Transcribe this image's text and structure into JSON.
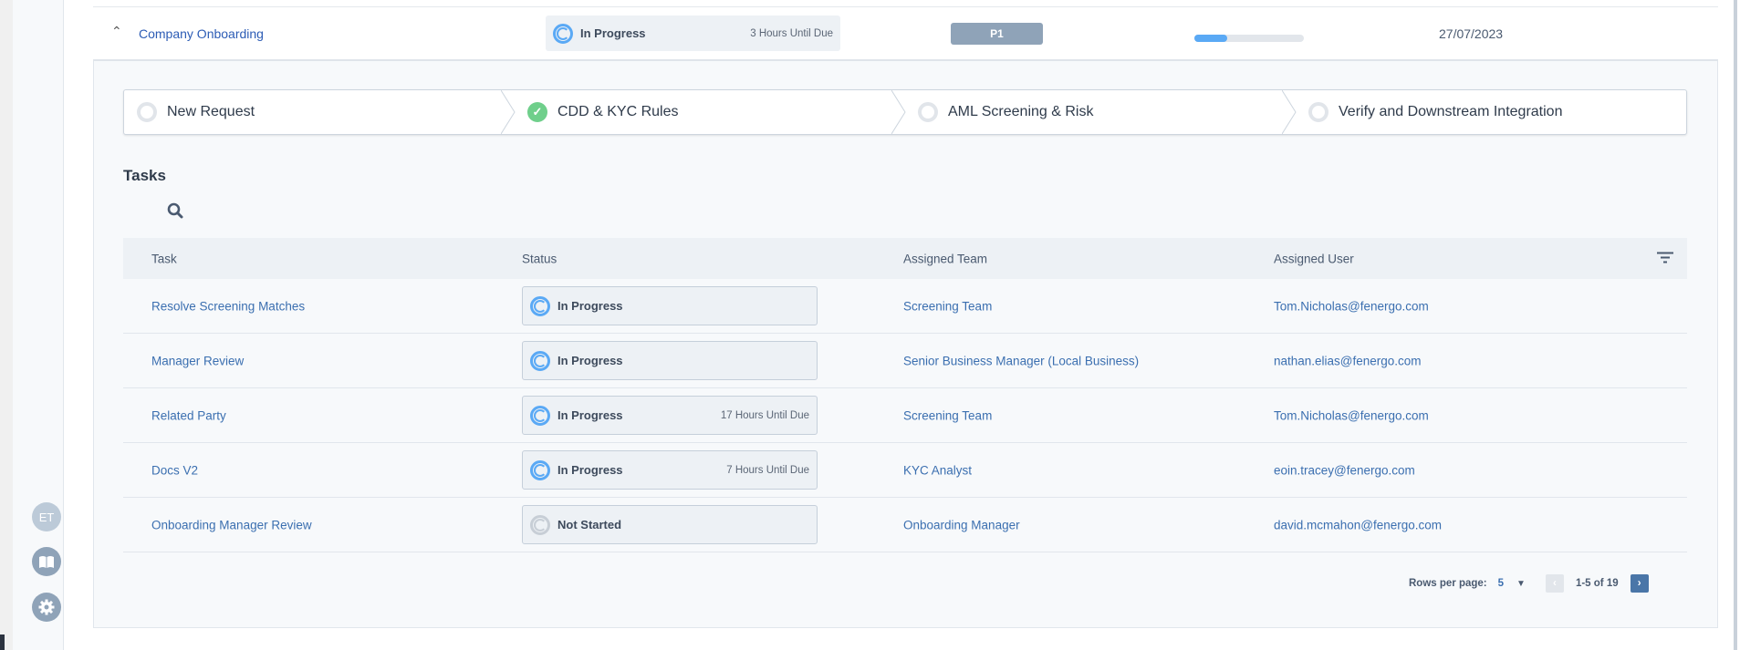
{
  "sidebar": {
    "avatar_initials": "ET",
    "icons": [
      "book-icon",
      "gear-icon"
    ]
  },
  "case": {
    "title": "Company Onboarding",
    "status": "In Progress",
    "due": "3 Hours Until Due",
    "priority": "P1",
    "progress_percent": 30,
    "date": "27/07/2023"
  },
  "stepper": [
    {
      "label": "New Request",
      "state": "pending"
    },
    {
      "label": "CDD & KYC Rules",
      "state": "complete"
    },
    {
      "label": "AML Screening & Risk",
      "state": "pending"
    },
    {
      "label": "Verify and Downstream Integration",
      "state": "pending"
    }
  ],
  "tasks": {
    "title": "Tasks",
    "columns": [
      "Task",
      "Status",
      "Assigned Team",
      "Assigned User"
    ],
    "rows": [
      {
        "task": "Resolve Screening Matches",
        "status": "In Progress",
        "due": "",
        "team": "Screening Team",
        "user": "Tom.Nicholas@fenergo.com"
      },
      {
        "task": "Manager Review",
        "status": "In Progress",
        "due": "",
        "team": "Senior Business Manager (Local Business)",
        "user": "nathan.elias@fenergo.com"
      },
      {
        "task": "Related Party",
        "status": "In Progress",
        "due": "17 Hours Until Due",
        "team": "Screening Team",
        "user": "Tom.Nicholas@fenergo.com"
      },
      {
        "task": "Docs V2",
        "status": "In Progress",
        "due": "7 Hours Until Due",
        "team": "KYC Analyst",
        "user": "eoin.tracey@fenergo.com"
      },
      {
        "task": "Onboarding Manager Review",
        "status": "Not Started",
        "due": "",
        "team": "Onboarding Manager",
        "user": "david.mcmahon@fenergo.com"
      }
    ]
  },
  "pagination": {
    "rows_label": "Rows per page:",
    "rows_value": "5",
    "range": "1-5 of 19"
  },
  "colors": {
    "accent": "#4a76a8",
    "in_progress": "#5aa9f5",
    "complete": "#6fcf8b",
    "priority": "#8fa3b8"
  }
}
